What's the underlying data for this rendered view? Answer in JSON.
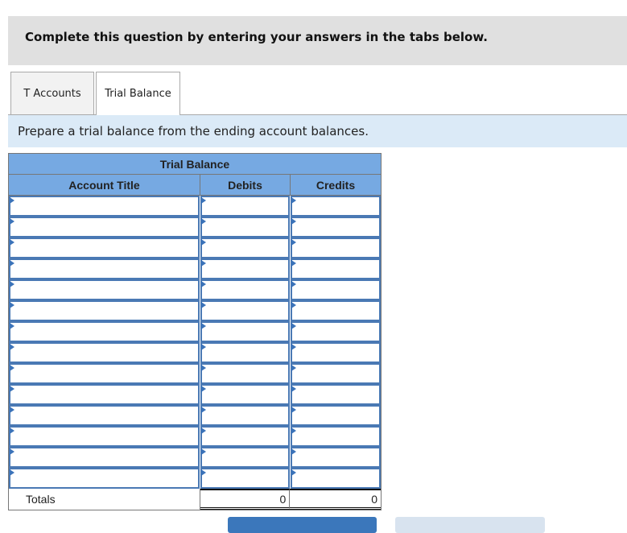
{
  "banner": {
    "text": "Complete this question by entering your answers in the tabs below."
  },
  "tabs": [
    {
      "label": "T Accounts",
      "active": false
    },
    {
      "label": "Trial Balance",
      "active": true
    }
  ],
  "instruction": "Prepare a trial balance from the ending account balances.",
  "trial_balance": {
    "title": "Trial Balance",
    "columns": [
      "Account Title",
      "Debits",
      "Credits"
    ],
    "rows": [
      {
        "account": "",
        "debit": "",
        "credit": ""
      },
      {
        "account": "",
        "debit": "",
        "credit": ""
      },
      {
        "account": "",
        "debit": "",
        "credit": ""
      },
      {
        "account": "",
        "debit": "",
        "credit": ""
      },
      {
        "account": "",
        "debit": "",
        "credit": ""
      },
      {
        "account": "",
        "debit": "",
        "credit": ""
      },
      {
        "account": "",
        "debit": "",
        "credit": ""
      },
      {
        "account": "",
        "debit": "",
        "credit": ""
      },
      {
        "account": "",
        "debit": "",
        "credit": ""
      },
      {
        "account": "",
        "debit": "",
        "credit": ""
      },
      {
        "account": "",
        "debit": "",
        "credit": ""
      },
      {
        "account": "",
        "debit": "",
        "credit": ""
      },
      {
        "account": "",
        "debit": "",
        "credit": ""
      },
      {
        "account": "",
        "debit": "",
        "credit": ""
      }
    ],
    "totals": {
      "label": "Totals",
      "debit": "0",
      "credit": "0"
    }
  },
  "colors": {
    "header_blue": "#76a9e2",
    "input_border": "#4a79b4",
    "instruction_bg": "#dbeaf7",
    "banner_bg": "#e0e0e0"
  }
}
